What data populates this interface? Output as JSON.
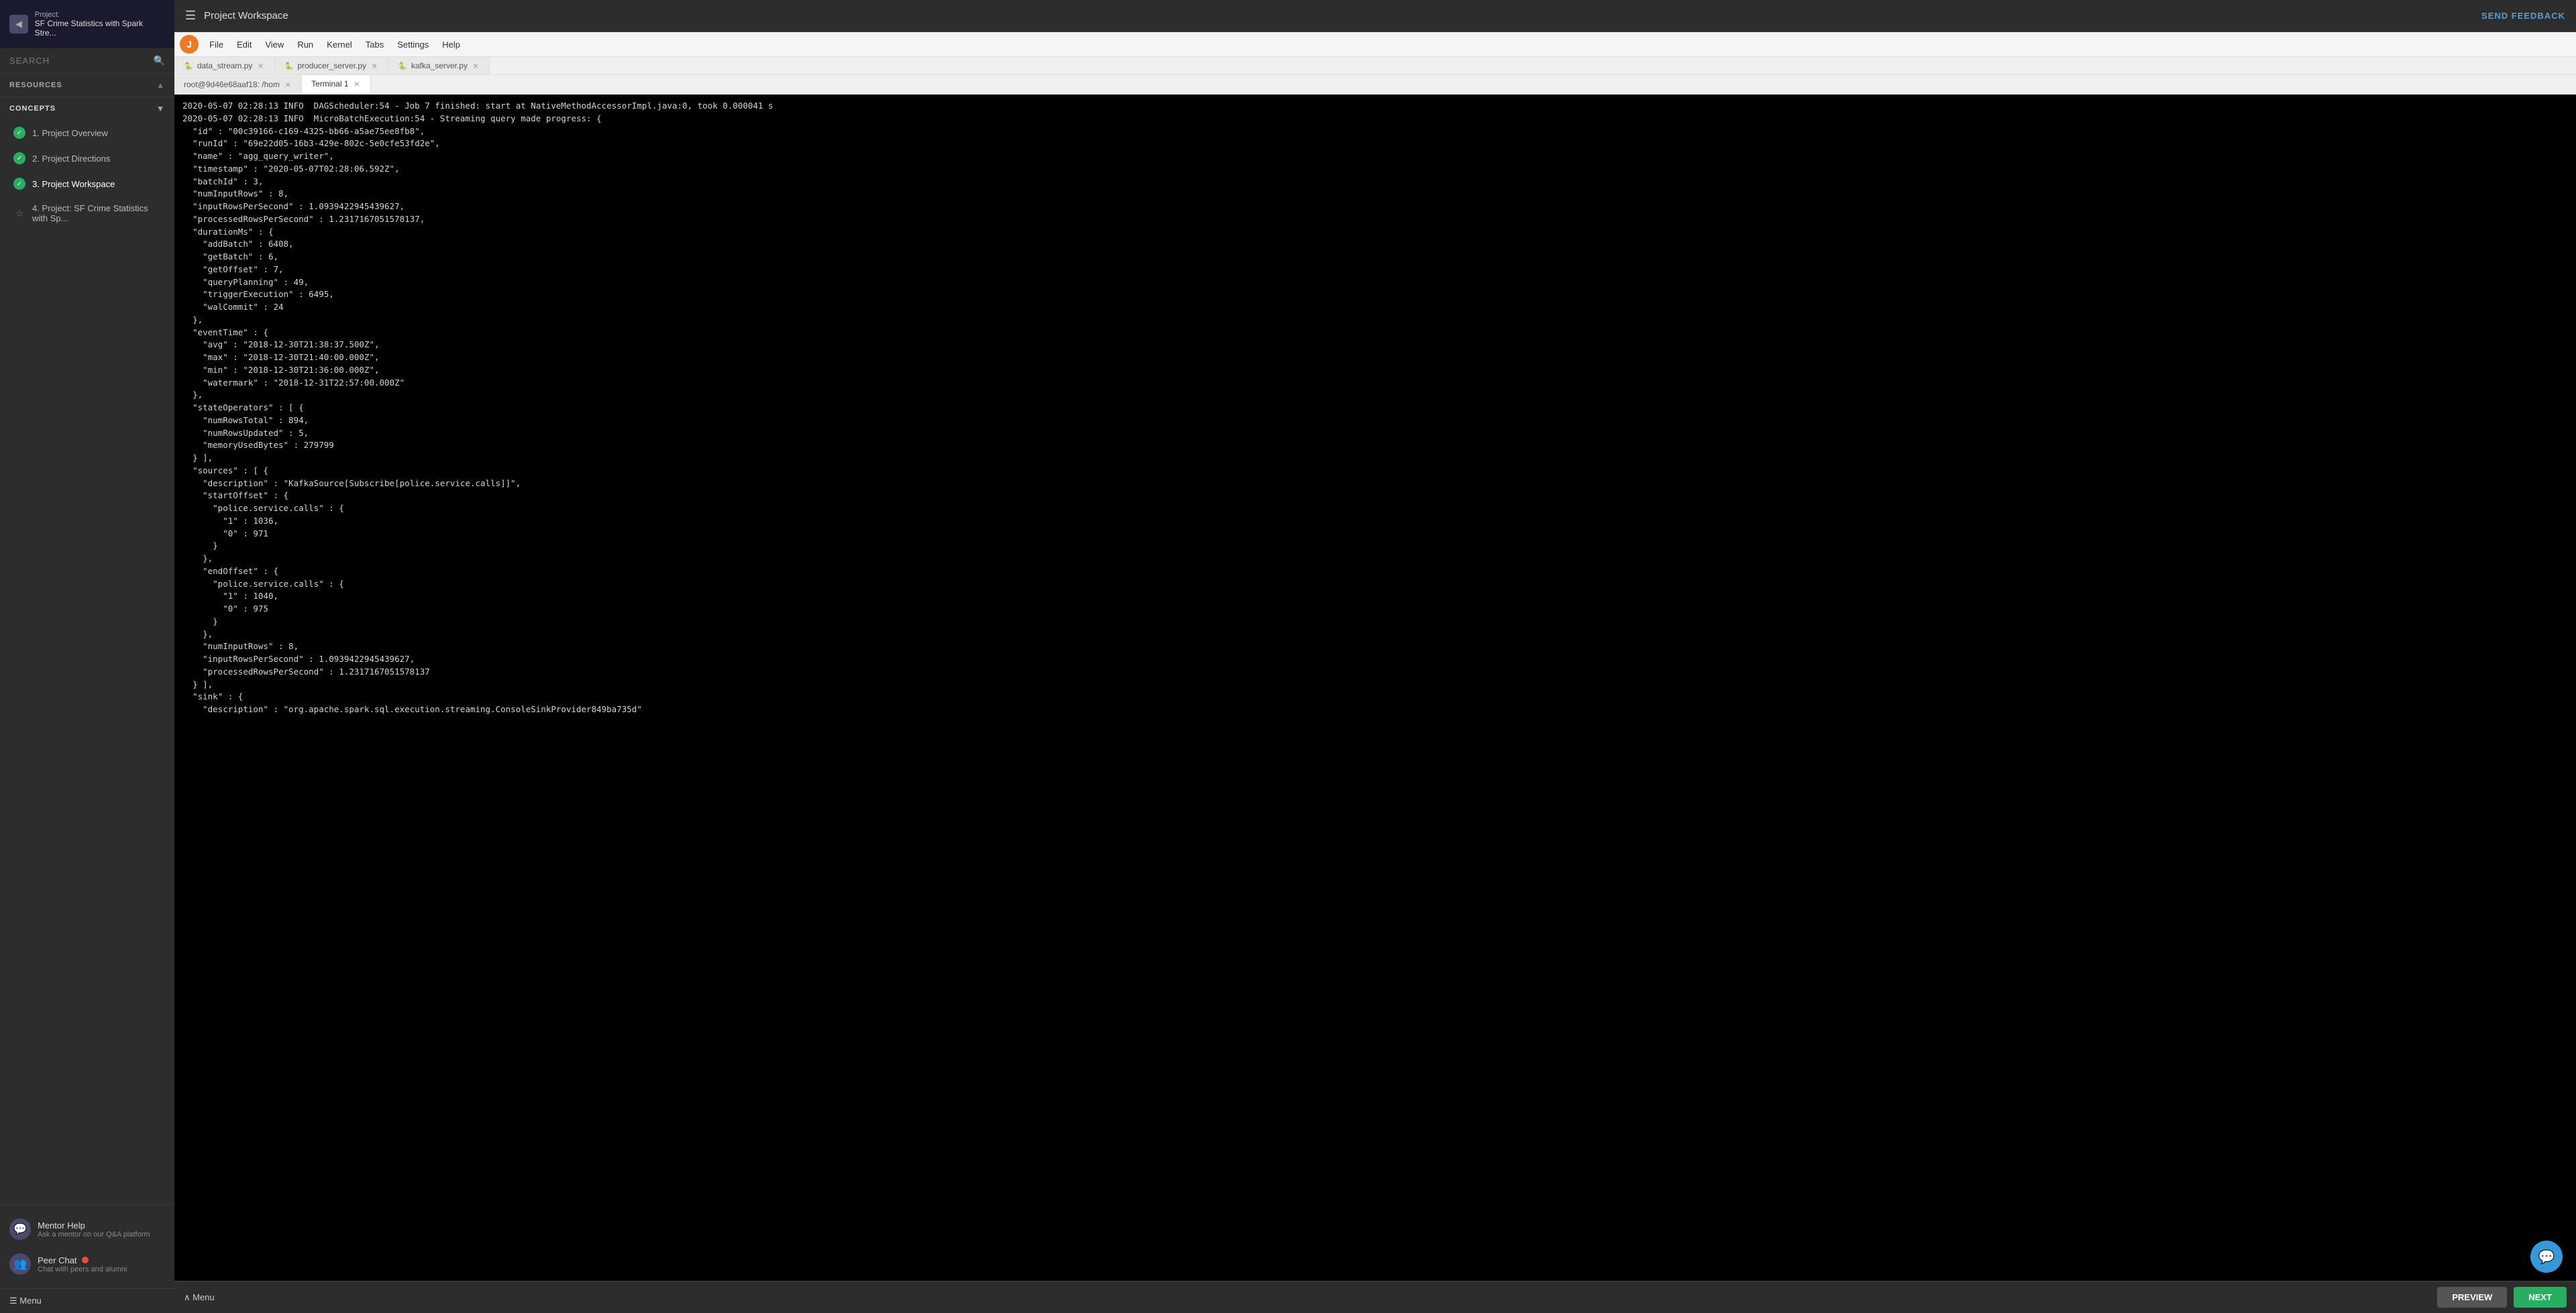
{
  "sidebar": {
    "back_arrow": "◀",
    "project_label": "Project:",
    "project_name": "SF Crime Statistics with Spark Stre...",
    "search_placeholder": "SEARCH",
    "search_icon": "🔍",
    "resources_label": "RESOURCES",
    "resources_chevron": "▲",
    "concepts_label": "CONCEPTS",
    "concepts_chevron": "▼",
    "nav_items": [
      {
        "id": "1",
        "label": "1. Project Overview",
        "status": "check",
        "active": false
      },
      {
        "id": "2",
        "label": "2. Project Directions",
        "status": "check",
        "active": false
      },
      {
        "id": "3",
        "label": "3. Project Workspace",
        "status": "check",
        "active": true
      },
      {
        "id": "4",
        "label": "4. Project: SF Crime Statistics with Sp...",
        "status": "star",
        "active": false
      }
    ],
    "mentor_help": {
      "title": "Mentor Help",
      "subtitle": "Ask a mentor on our Q&A platform",
      "icon": "💬"
    },
    "peer_chat": {
      "title": "Peer Chat",
      "subtitle": "Chat with peers and alumni",
      "icon": "👥"
    },
    "menu_label": "☰ Menu"
  },
  "topbar": {
    "hamburger": "☰",
    "title": "Project Workspace",
    "send_feedback": "SEND FEEDBACK"
  },
  "jupyter": {
    "logo": "J",
    "menu_items": [
      "File",
      "Edit",
      "View",
      "Run",
      "Kernel",
      "Tabs",
      "Settings",
      "Help"
    ]
  },
  "file_tabs": [
    {
      "name": "data_stream.py",
      "active": false,
      "closeable": true
    },
    {
      "name": "producer_server.py",
      "active": false,
      "closeable": true
    },
    {
      "name": "kafka_server.py",
      "active": false,
      "closeable": true
    },
    {
      "name": "root@9d46e68aaf18: /hom",
      "active": false,
      "closeable": true
    },
    {
      "name": "Terminal 1",
      "active": true,
      "closeable": true
    }
  ],
  "terminal_content": "2020-05-07 02:28:13 INFO  DAGScheduler:54 - Job 7 finished: start at NativeMethodAccessorImpl.java:0, took 0.000041 s\n2020-05-07 02:28:13 INFO  MicroBatchExecution:54 - Streaming query made progress: {\n  \"id\" : \"00c39166-c169-4325-bb66-a5ae75ee8fb8\",\n  \"runId\" : \"69e22d05-16b3-429e-802c-5e0cfe53fd2e\",\n  \"name\" : \"agg_query_writer\",\n  \"timestamp\" : \"2020-05-07T02:28:06.592Z\",\n  \"batchId\" : 3,\n  \"numInputRows\" : 8,\n  \"inputRowsPerSecond\" : 1.0939422945439627,\n  \"processedRowsPerSecond\" : 1.2317167051578137,\n  \"durationMs\" : {\n    \"addBatch\" : 6408,\n    \"getBatch\" : 6,\n    \"getOffset\" : 7,\n    \"queryPlanning\" : 49,\n    \"triggerExecution\" : 6495,\n    \"walCommit\" : 24\n  },\n  \"eventTime\" : {\n    \"avg\" : \"2018-12-30T21:38:37.500Z\",\n    \"max\" : \"2018-12-30T21:40:00.000Z\",\n    \"min\" : \"2018-12-30T21:36:00.000Z\",\n    \"watermark\" : \"2018-12-31T22:57:00.000Z\"\n  },\n  \"stateOperators\" : [ {\n    \"numRowsTotal\" : 894,\n    \"numRowsUpdated\" : 5,\n    \"memoryUsedBytes\" : 279799\n  } ],\n  \"sources\" : [ {\n    \"description\" : \"KafkaSource[Subscribe[police.service.calls]]\",\n    \"startOffset\" : {\n      \"police.service.calls\" : {\n        \"1\" : 1036,\n        \"0\" : 971\n      }\n    },\n    \"endOffset\" : {\n      \"police.service.calls\" : {\n        \"1\" : 1040,\n        \"0\" : 975\n      }\n    },\n    \"numInputRows\" : 8,\n    \"inputRowsPerSecond\" : 1.0939422945439627,\n    \"processedRowsPerSecond\" : 1.2317167051578137\n  } ],\n  \"sink\" : {\n    \"description\" : \"org.apache.spark.sql.execution.streaming.ConsoleSinkProvider849ba735d\"",
  "bottom": {
    "menu_label": "∧ Menu",
    "preview_label": "PREVIEW",
    "next_label": "NEXT"
  },
  "icons": {
    "sidebar_icons": [
      "☰",
      "📁",
      "◉",
      "📁"
    ]
  }
}
